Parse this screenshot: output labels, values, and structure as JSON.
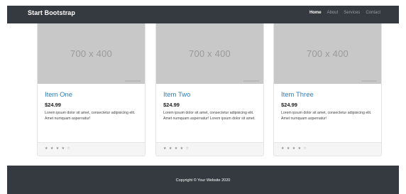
{
  "navbar": {
    "brand": "Start Bootstrap",
    "links": [
      {
        "label": "Home",
        "active": true
      },
      {
        "label": "About",
        "active": false
      },
      {
        "label": "Services",
        "active": false
      },
      {
        "label": "Contact",
        "active": false
      }
    ]
  },
  "cards": [
    {
      "image_label": "700 x 400",
      "title": "Item One",
      "price": "$24.99",
      "description": "Lorem ipsum dolor sit amet, consectetur adipisicing elit. Amet numquam aspernatur!",
      "rating": 4,
      "stars_text": "★ ★ ★ ★ ☆"
    },
    {
      "image_label": "700 x 400",
      "title": "Item Two",
      "price": "$24.99",
      "description": "Lorem ipsum dolor sit amet, consectetur adipisicing elit. Amet numquam aspernatur! Lorem ipsum dolor sit amet.",
      "rating": 4,
      "stars_text": "★ ★ ★ ★ ☆"
    },
    {
      "image_label": "700 x 400",
      "title": "Item Three",
      "price": "$24.99",
      "description": "Lorem ipsum dolor sit amet, consectetur adipisicing elit. Amet numquam aspernatur!",
      "rating": 4,
      "stars_text": "★ ★ ★ ★ ☆"
    }
  ],
  "footer": {
    "copyright": "Copyright © Your Website 2020"
  },
  "colors": {
    "navbar_bg": "#343a40",
    "title_link": "#2f7fb8",
    "image_placeholder_bg": "#c8c8c8"
  }
}
